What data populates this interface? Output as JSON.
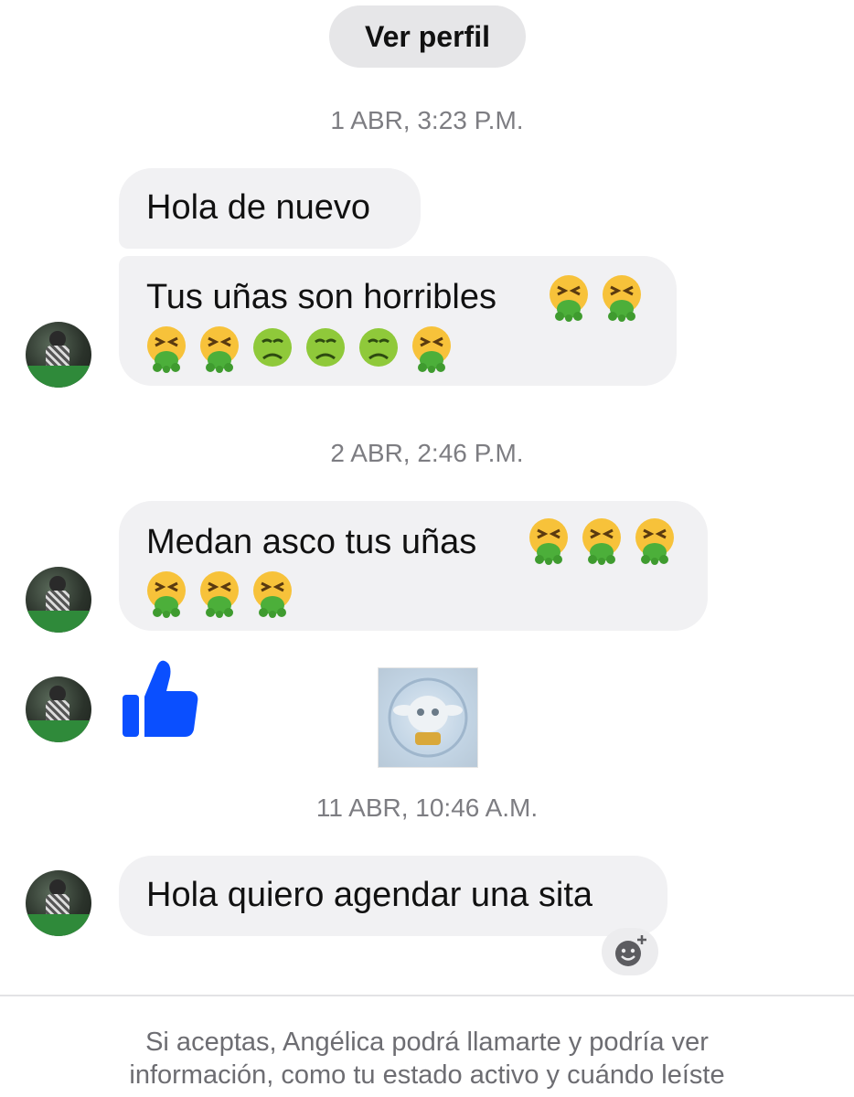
{
  "header": {
    "view_profile_label": "Ver perfil"
  },
  "timestamps": {
    "t1": "1 ABR, 3:23 P.M.",
    "t2": "2 ABR, 2:46 P.M.",
    "t3": "11 ABR, 10:46 A.M."
  },
  "messages": [
    {
      "text": "Hola de nuevo"
    },
    {
      "text": "Tus uñas son horribles",
      "emojis_line1": [
        "vomit",
        "vomit"
      ],
      "emojis_line2": [
        "vomit",
        "vomit",
        "nauseated",
        "nauseated",
        "nauseated",
        "vomit"
      ]
    },
    {
      "text": "Medan asco tus uñas",
      "emojis_line1": [
        "vomit",
        "vomit",
        "vomit"
      ],
      "emojis_line2": [
        "vomit",
        "vomit",
        "vomit"
      ]
    },
    {
      "text": "Hola quiero agendar una sita"
    }
  ],
  "icons": {
    "like": "thumbs-up-icon",
    "reaction": "add-reaction-icon",
    "avatar": "avatar"
  },
  "colors": {
    "like_blue": "#0a4fff",
    "bubble_bg": "#f1f1f3",
    "timestamp": "#7d7d82"
  },
  "footer": {
    "line1": "Si aceptas, Angélica podrá llamarte y podría ver",
    "line2": "información, como tu estado activo y cuándo leíste"
  }
}
